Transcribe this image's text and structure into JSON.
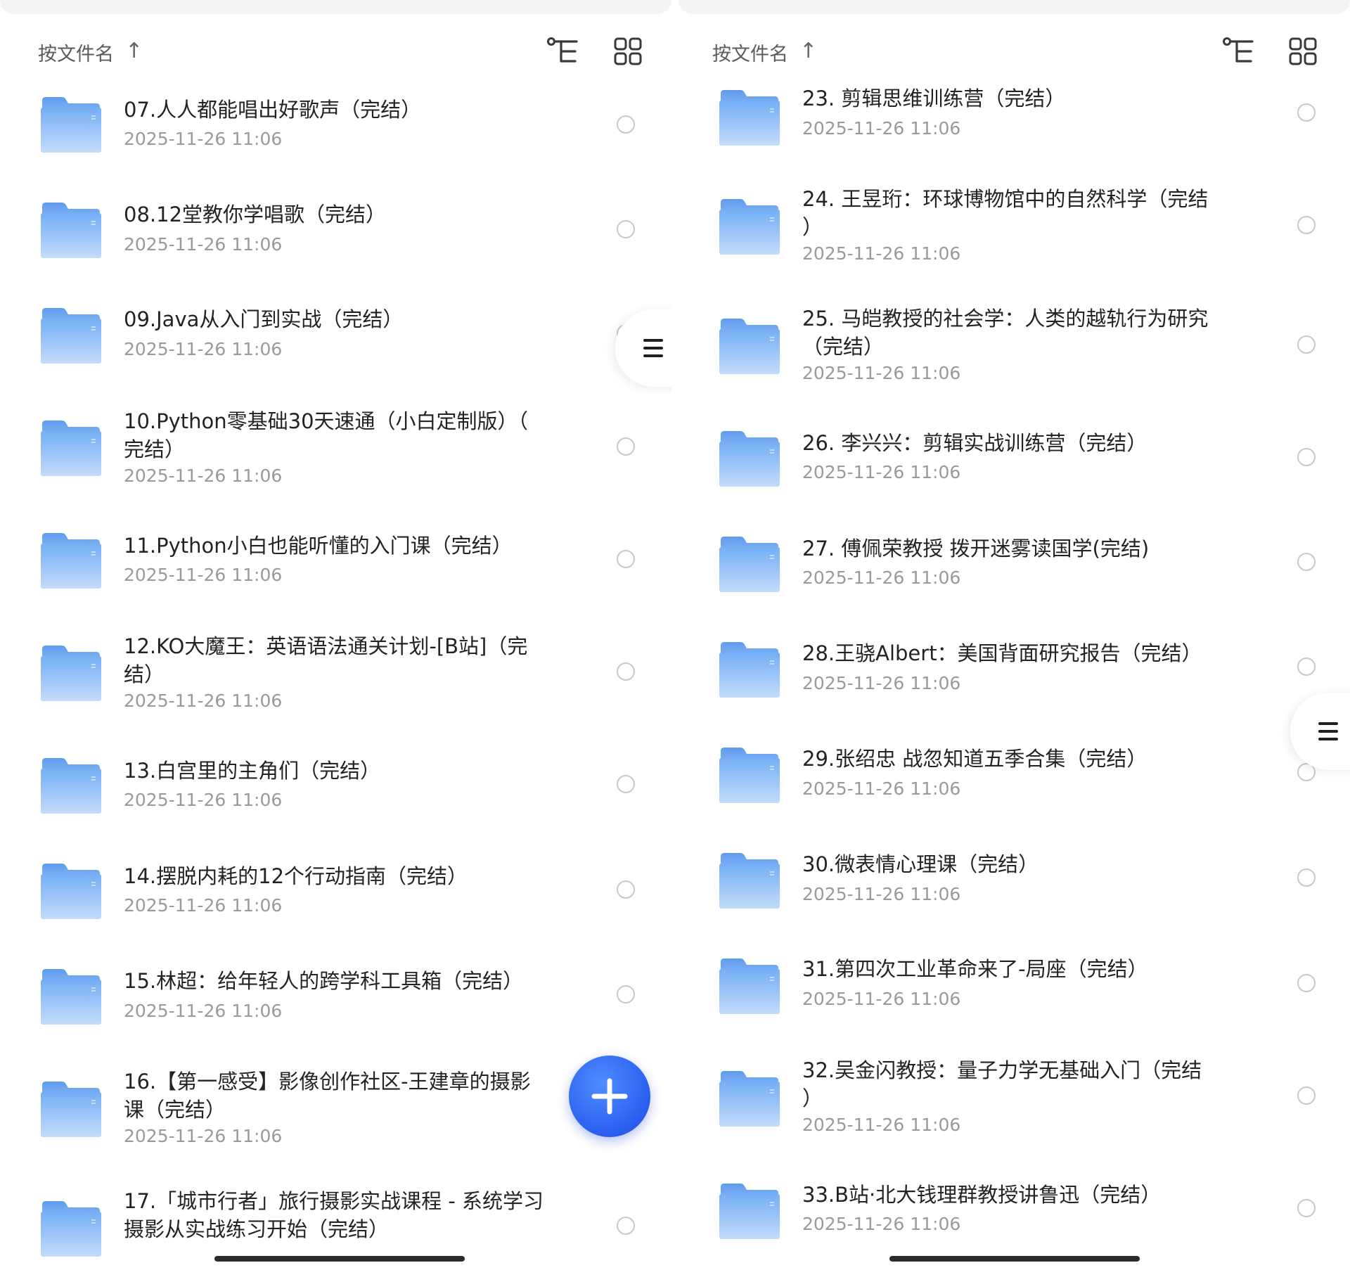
{
  "colors": {
    "folder_top": "#74aef5",
    "folder_bottom": "#c3dcfb",
    "fab": "#2a5ef0",
    "text": "#232323",
    "subtext": "#9a9a9a"
  },
  "left": {
    "sort": {
      "label": "按文件名",
      "arrow": "↑"
    },
    "icons": [
      "tree-view-icon",
      "grid-view-icon"
    ],
    "items": [
      {
        "title": "07.人人都能唱出好歌声（完结）",
        "date": "2025-11-26 11:06"
      },
      {
        "title": "08.12堂教你学唱歌（完结）",
        "date": "2025-11-26 11:06"
      },
      {
        "title": "09.Java从入门到实战（完结）",
        "date": "2025-11-26 11:06"
      },
      {
        "title": "10.Python零基础30天速通（小白定制版）（\n完结）",
        "date": "2025-11-26 11:06"
      },
      {
        "title": "11.Python小白也能听懂的入门课（完结）",
        "date": "2025-11-26 11:06"
      },
      {
        "title": "12.KO大魔王：英语语法通关计划-[B站]（完\n结）",
        "date": "2025-11-26 11:06"
      },
      {
        "title": "13.白宫里的主角们（完结）",
        "date": "2025-11-26 11:06"
      },
      {
        "title": "14.摆脱内耗的12个行动指南（完结）",
        "date": "2025-11-26 11:06"
      },
      {
        "title": "15.林超：给年轻人的跨学科工具箱（完结）",
        "date": "2025-11-26 11:06"
      },
      {
        "title": "16.【第一感受】影像创作社区-王建章的摄影\n课（完结）",
        "date": "2025-11-26 11:06"
      },
      {
        "title": "17.「城市行者」旅行摄影实战课程 - 系统学习\n摄影从实战练习开始（完结）",
        "date": ""
      }
    ]
  },
  "right": {
    "sort": {
      "label": "按文件名",
      "arrow": "↑"
    },
    "icons": [
      "tree-view-icon",
      "grid-view-icon"
    ],
    "items": [
      {
        "title": "23. 剪辑思维训练营（完结）",
        "date": "2025-11-26 11:06"
      },
      {
        "title": "24. 王昱珩：环球博物馆中的自然科学（完结\n）",
        "date": "2025-11-26 11:06"
      },
      {
        "title": "25. 马皑教授的社会学：人类的越轨行为研究\n（完结）",
        "date": "2025-11-26 11:06"
      },
      {
        "title": "26. 李兴兴：剪辑实战训练营（完结）",
        "date": "2025-11-26 11:06"
      },
      {
        "title": "27. 傅佩荣教授 拨开迷雾读国学(完结)",
        "date": "2025-11-26 11:06"
      },
      {
        "title": "28.王骁Albert：美国背面研究报告（完结）",
        "date": "2025-11-26 11:06"
      },
      {
        "title": "29.张绍忠 战忽知道五季合集（完结）",
        "date": "2025-11-26 11:06"
      },
      {
        "title": "30.微表情心理课（完结）",
        "date": "2025-11-26 11:06"
      },
      {
        "title": "31.第四次工业革命来了-局座（完结）",
        "date": "2025-11-26 11:06"
      },
      {
        "title": "32.吴金闪教授：量子力学无基础入门（完结\n）",
        "date": "2025-11-26 11:06"
      },
      {
        "title": "33.B站·北大钱理群教授讲鲁迅（完结）",
        "date": "2025-11-26 11:06"
      }
    ]
  },
  "fab": {
    "icon": "plus-icon"
  },
  "side_tab": {
    "icon": "menu-icon"
  }
}
